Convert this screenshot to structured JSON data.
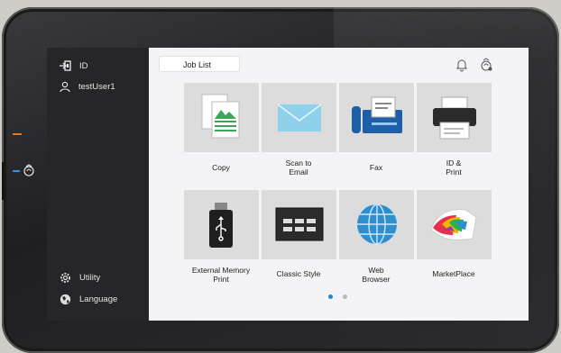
{
  "sidebar": {
    "id_label": "ID",
    "user_label": "testUser1",
    "utility_label": "Utility",
    "language_label": "Language"
  },
  "header": {
    "job_list_label": "Job List"
  },
  "apps": [
    {
      "label": "Copy",
      "icon": "copy-icon"
    },
    {
      "label": "Scan to\nEmail",
      "icon": "email-envelope-icon"
    },
    {
      "label": "Fax",
      "icon": "fax-icon"
    },
    {
      "label": "ID &\nPrint",
      "icon": "printer-icon"
    },
    {
      "label": "External Memory\nPrint",
      "icon": "usb-drive-icon"
    },
    {
      "label": "Classic Style",
      "icon": "classic-keypad-icon"
    },
    {
      "label": "Web\nBrowser",
      "icon": "globe-icon"
    },
    {
      "label": "MarketPlace",
      "icon": "marketplace-icon"
    }
  ],
  "pagination": {
    "current_page": 1,
    "total_pages": 2
  },
  "colors": {
    "accent": "#2f7fc1",
    "sidebar_bg": "#262628",
    "tile_bg": "#dcdcdc"
  }
}
